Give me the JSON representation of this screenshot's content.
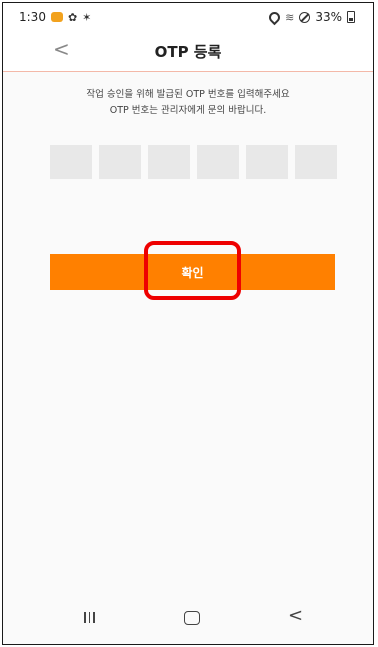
{
  "status_bar": {
    "time": "1:30",
    "battery": "33%"
  },
  "header": {
    "back_glyph": "<",
    "title": "OTP 등록"
  },
  "instructions": {
    "line1": "작업 승인을 위해 발급된 OTP 번호를 입력해주세요",
    "line2": "OTP 번호는 관리자에게 문의 바랍니다."
  },
  "otp": {
    "digits": [
      "",
      "",
      "",
      "",
      "",
      ""
    ]
  },
  "confirm_button": {
    "label": "확인",
    "color": "#ff8000"
  },
  "highlight": {
    "color": "#ee0000"
  },
  "nav_bar": {
    "back_glyph": "<"
  },
  "icons": [
    "notification-icon",
    "settings-icon",
    "star-icon",
    "location-icon",
    "wifi-icon",
    "do-not-disturb-icon",
    "battery-icon",
    "recent-apps-icon",
    "home-icon",
    "back-icon"
  ]
}
